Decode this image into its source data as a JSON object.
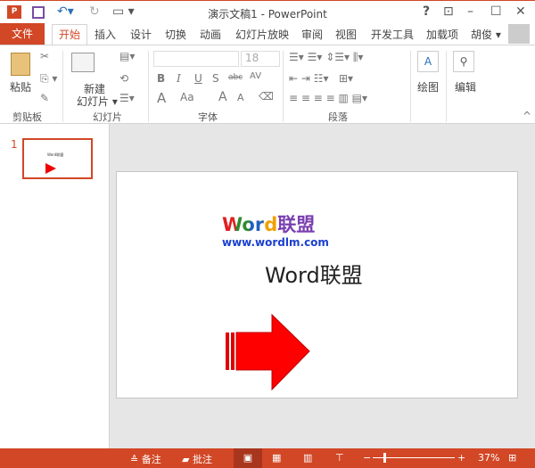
{
  "titlebar": {
    "title": "演示文稿1 - PowerPoint",
    "help": "?",
    "app_icon": "powerpoint-icon"
  },
  "tabs": {
    "file": "文件",
    "items": [
      "开始",
      "插入",
      "设计",
      "切换",
      "动画",
      "幻灯片放映",
      "审阅",
      "视图",
      "开发工具",
      "加载项"
    ],
    "user": "胡俊 ▾"
  },
  "ribbon": {
    "clipboard": {
      "paste": "粘贴",
      "label": "剪贴板"
    },
    "slides": {
      "new_slide_1": "新建",
      "new_slide_2": "幻灯片 ▾",
      "label": "幻灯片"
    },
    "font": {
      "size": "18",
      "bold": "B",
      "italic": "I",
      "underline": "U",
      "strike": "S",
      "abc": "abc",
      "spacing": "AV",
      "fontcolor": "A",
      "case": "Aa",
      "grow": "A",
      "shrink": "A",
      "label": "字体"
    },
    "paragraph": {
      "label": "段落"
    },
    "drawing": {
      "label": "绘图"
    },
    "editing": {
      "label": "编辑"
    }
  },
  "thumbnails": [
    {
      "number": "1",
      "text": "Word联盟"
    }
  ],
  "slide": {
    "logo_word": "Word",
    "logo_cn": "联盟",
    "logo_url": "www.wordlm.com",
    "title": "Word联盟"
  },
  "status": {
    "notes": "备注",
    "comments": "批注",
    "zoom": "37%",
    "zoom_level": 37
  }
}
